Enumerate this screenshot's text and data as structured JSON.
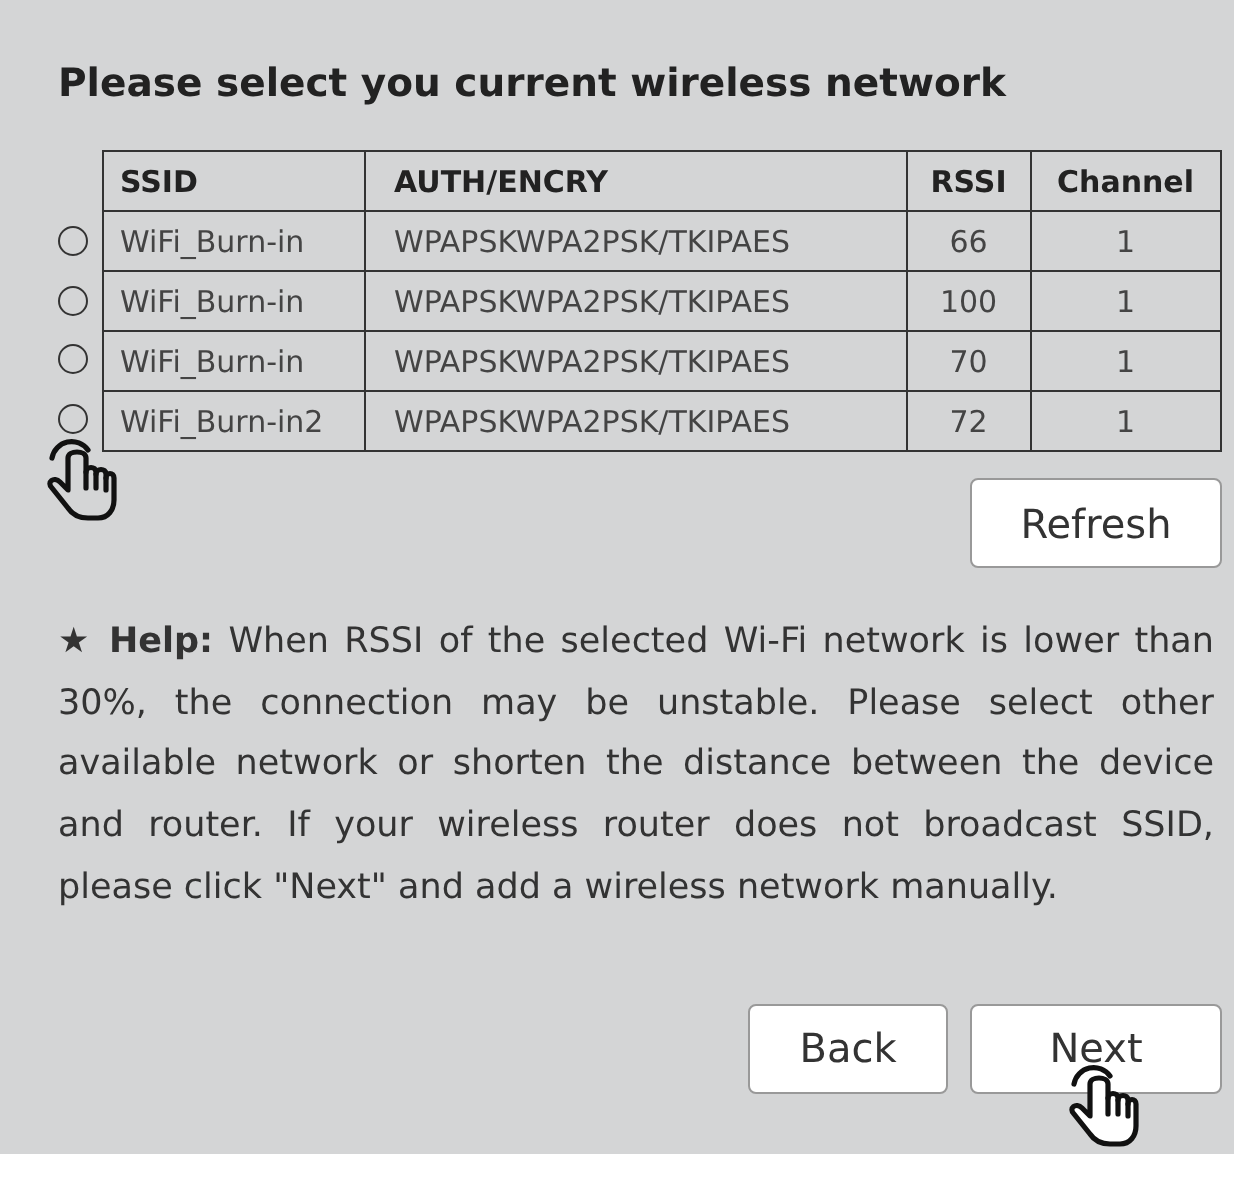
{
  "title": "Please select you current wireless network",
  "table": {
    "columns": [
      "SSID",
      "AUTH/ENCRY",
      "RSSI",
      "Channel"
    ],
    "rows": [
      {
        "selected": false,
        "cells": [
          "WiFi_Burn-in",
          "WPAPSKWPA2PSK/TKIPAES",
          "66",
          "1"
        ]
      },
      {
        "selected": false,
        "cells": [
          "WiFi_Burn-in",
          "WPAPSKWPA2PSK/TKIPAES",
          "100",
          "1"
        ]
      },
      {
        "selected": false,
        "cells": [
          "WiFi_Burn-in",
          "WPAPSKWPA2PSK/TKIPAES",
          "70",
          "1"
        ]
      },
      {
        "selected": false,
        "cells": [
          "WiFi_Burn-in2",
          "WPAPSKWPA2PSK/TKIPAES",
          "72",
          "1"
        ]
      }
    ]
  },
  "refresh_button": "Refresh",
  "help": "★ **Help:** When RSSI of the selected Wi-Fi network is lower than 30%, the connection may be unstable. Please select other available network or shorten the distance between the device and router. If your wireless router does not broadcast SSID, please click \"Next\" and add a wireless network manually.",
  "buttons": [
    "Back",
    "Next"
  ]
}
